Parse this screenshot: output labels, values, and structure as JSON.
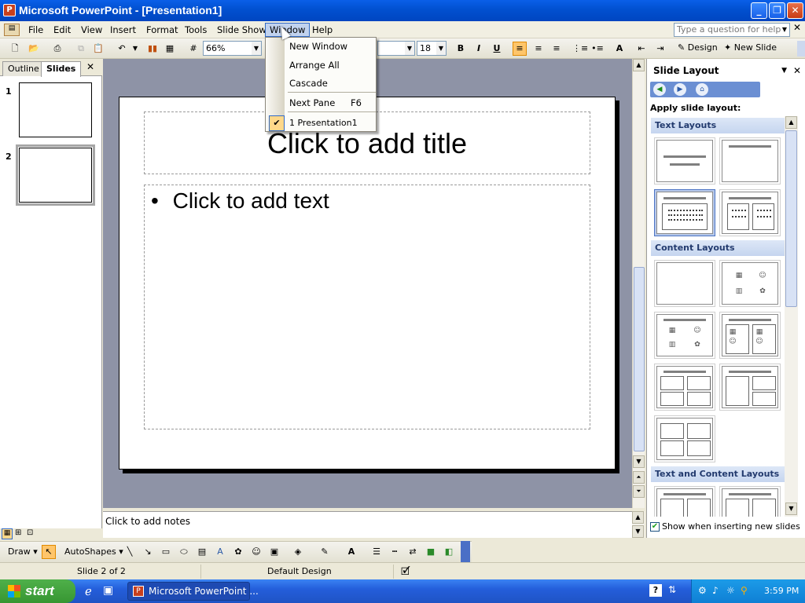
{
  "window": {
    "title": "Microsoft PowerPoint - [Presentation1]",
    "app_icon": "powerpoint-icon"
  },
  "menubar": {
    "items": [
      "File",
      "Edit",
      "View",
      "Insert",
      "Format",
      "Tools",
      "Slide Show",
      "Window",
      "Help"
    ],
    "help_placeholder": "Type a question for help"
  },
  "toolbar": {
    "zoom": "66%",
    "font_size": "18",
    "design_label": "Design",
    "new_slide_label": "New Slide"
  },
  "window_menu": {
    "new_window": "New Window",
    "arrange_all": "Arrange All",
    "cascade": "Cascade",
    "next_pane": "Next Pane",
    "next_pane_shortcut": "F6",
    "presentation": "1 Presentation1"
  },
  "left_pane": {
    "tab_outline": "Outline",
    "tab_slides": "Slides",
    "slide1_num": "1",
    "slide2_num": "2"
  },
  "slide": {
    "title_placeholder": "Click to add title",
    "bullet": "•",
    "body_placeholder": "Click to add text"
  },
  "notes": {
    "placeholder": "Click to add notes"
  },
  "task_pane": {
    "title": "Slide Layout",
    "apply_label": "Apply slide layout:",
    "section_text": "Text Layouts",
    "section_content": "Content Layouts",
    "section_text_content": "Text and Content Layouts",
    "show_when_inserting": "Show when inserting new slides"
  },
  "drawing_toolbar": {
    "draw_label": "Draw",
    "autoshapes_label": "AutoShapes"
  },
  "status": {
    "slide_info": "Slide 2 of 2",
    "design": "Default Design"
  },
  "taskbar": {
    "start_label": "start",
    "task_item": "Microsoft PowerPoint ...",
    "clock": "3:59 PM"
  },
  "colors": {
    "title_bar": "#0150d0",
    "workspace": "#8e93a6",
    "menu_highlight": "#c1d2ee",
    "start_green": "#379632"
  }
}
